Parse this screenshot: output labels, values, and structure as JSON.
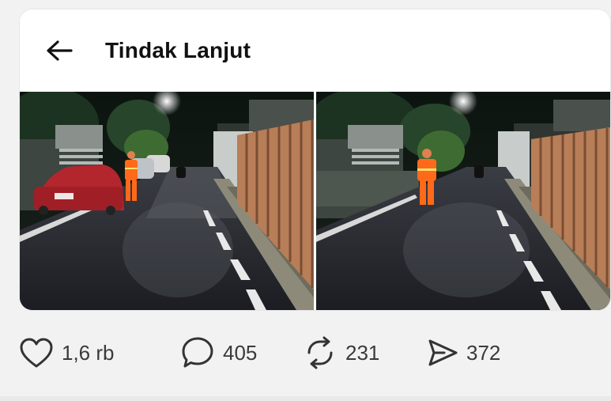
{
  "header": {
    "title": "Tindak Lanjut",
    "back_icon": "arrow-left-icon"
  },
  "photos": [
    {
      "name": "photo-street-with-car",
      "description_icon": "street-photo"
    },
    {
      "name": "photo-street-officer",
      "description_icon": "street-photo"
    }
  ],
  "actions": {
    "like": {
      "icon": "heart-icon",
      "count": "1,6 rb"
    },
    "reply": {
      "icon": "comment-icon",
      "count": "405"
    },
    "repost": {
      "icon": "repost-icon",
      "count": "231"
    },
    "share": {
      "icon": "send-icon",
      "count": "372"
    }
  },
  "colors": {
    "text": "#111111",
    "count_text": "#3a3a3a",
    "icon": "#333333",
    "background": "#f2f2f2",
    "card": "#ffffff"
  }
}
